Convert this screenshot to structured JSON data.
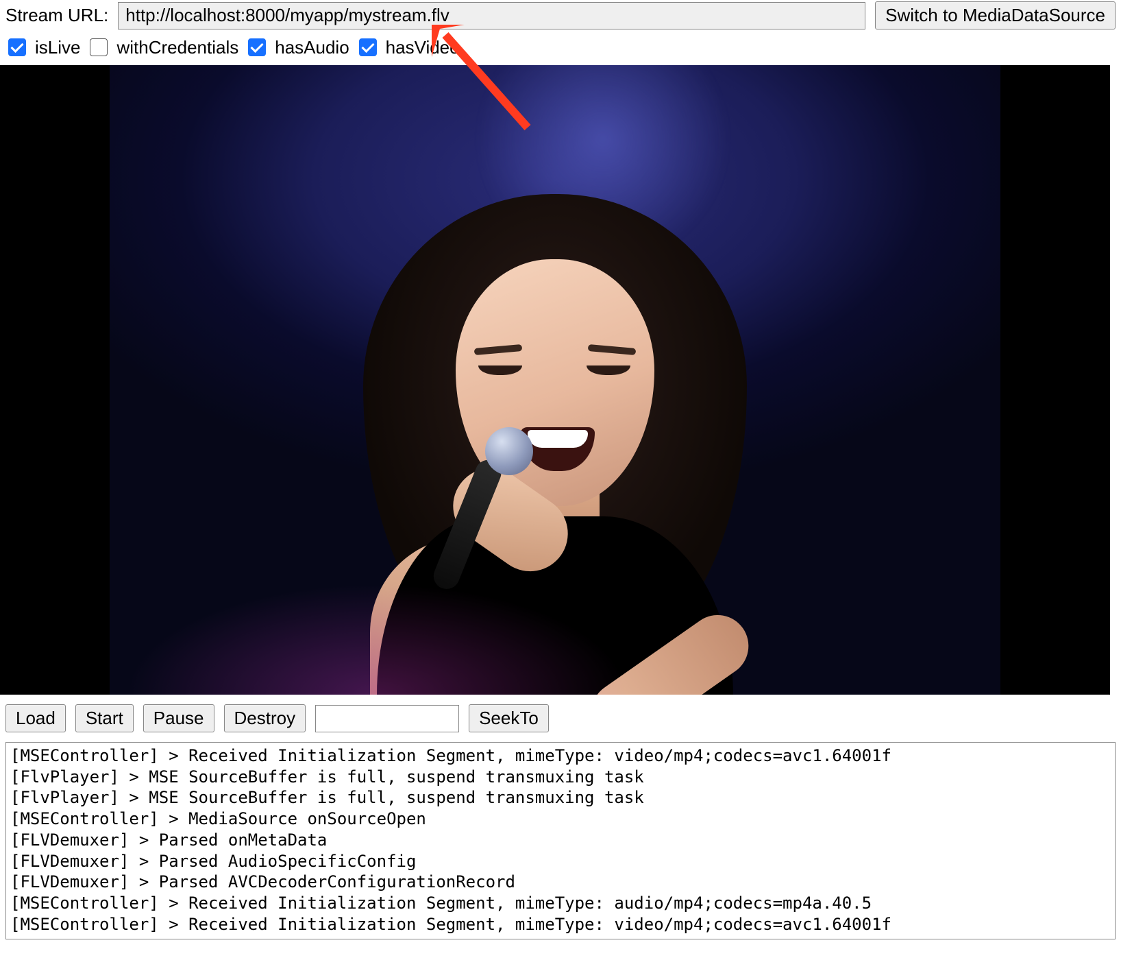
{
  "top": {
    "url_label": "Stream URL:",
    "url_value": "http://localhost:8000/myapp/mystream.flv",
    "switch_button": "Switch to MediaDataSource"
  },
  "options": {
    "isLive": {
      "label": "isLive",
      "checked": true
    },
    "withCredentials": {
      "label": "withCredentials",
      "checked": false
    },
    "hasAudio": {
      "label": "hasAudio",
      "checked": true
    },
    "hasVideo": {
      "label": "hasVideo",
      "checked": true
    }
  },
  "controls": {
    "load": "Load",
    "start": "Start",
    "pause": "Pause",
    "destroy": "Destroy",
    "seek_value": "",
    "seek_to": "SeekTo"
  },
  "log_lines": [
    "[MSEController] > Received Initialization Segment, mimeType: video/mp4;codecs=avc1.64001f",
    "[FlvPlayer] > MSE SourceBuffer is full, suspend transmuxing task",
    "[FlvPlayer] > MSE SourceBuffer is full, suspend transmuxing task",
    "[MSEController] > MediaSource onSourceOpen",
    "[FLVDemuxer] > Parsed onMetaData",
    "[FLVDemuxer] > Parsed AudioSpecificConfig",
    "[FLVDemuxer] > Parsed AVCDecoderConfigurationRecord",
    "[MSEController] > Received Initialization Segment, mimeType: audio/mp4;codecs=mp4a.40.5",
    "[MSEController] > Received Initialization Segment, mimeType: video/mp4;codecs=avc1.64001f"
  ]
}
